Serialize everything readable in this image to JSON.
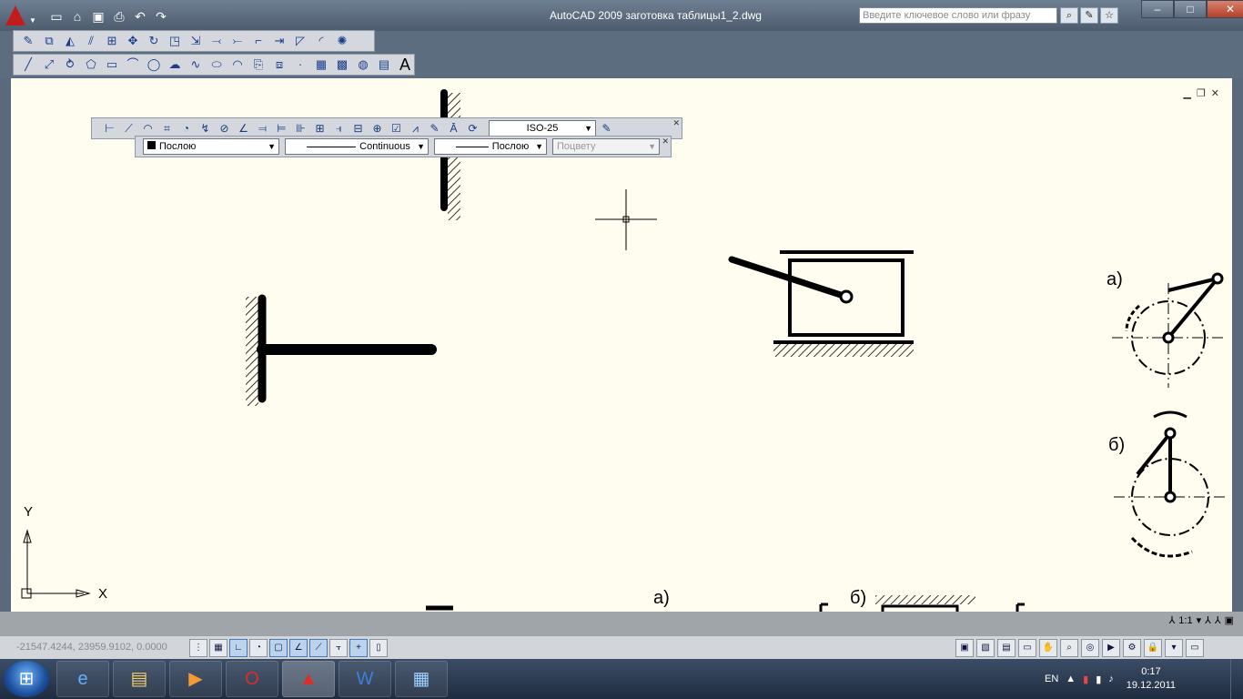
{
  "titlebar": {
    "title": "AutoCAD 2009 заготовка таблицы1_2.dwg",
    "search_placeholder": "Введите ключевое слово или фразу",
    "qat_icons": [
      "new-icon",
      "open-icon",
      "save-icon",
      "print-icon",
      "undo-icon",
      "redo-icon"
    ],
    "info_icons": [
      "search-icon",
      "communication-icon",
      "favorites-icon"
    ],
    "window_controls": {
      "minimize": "–",
      "maximize": "□",
      "close": "✕"
    }
  },
  "toolbars": {
    "modify_icons": [
      "erase-icon",
      "copy-icon",
      "mirror-icon",
      "offset-icon",
      "array-icon",
      "move-icon",
      "rotate-icon",
      "scale-icon",
      "stretch-icon",
      "trim-icon",
      "extend-icon",
      "break-icon",
      "join-icon",
      "chamfer-icon",
      "fillet-icon",
      "explode-icon"
    ],
    "draw_icons": [
      "line-icon",
      "construction-line-icon",
      "polyline-icon",
      "polygon-icon",
      "rectangle-icon",
      "arc-icon",
      "circle-icon",
      "revision-cloud-icon",
      "spline-icon",
      "ellipse-icon",
      "ellipse-arc-icon",
      "insert-block-icon",
      "make-block-icon",
      "point-icon",
      "hatch-icon",
      "gradient-icon",
      "region-icon",
      "table-icon",
      "multiline-text-icon"
    ],
    "multiline_text_label": "A"
  },
  "dimension_toolbar": {
    "dimstyle": "ISO-25"
  },
  "properties_toolbar": {
    "color": "Послою",
    "linetype": "Continuous",
    "lineweight": "Послою",
    "plotstyle": "Поцвету"
  },
  "drawing": {
    "labels": {
      "a_right": "а)",
      "b_right": "б)",
      "a_bottom": "а)",
      "b_bottom": "б)"
    },
    "ucs": {
      "x_label": "X",
      "y_label": "Y"
    }
  },
  "statusbar": {
    "coordinates": "-21547.4244, 23959.9102, 0.0000",
    "annotation_scale": "1:1"
  },
  "taskbar": {
    "language": "EN",
    "time": "0:17",
    "date": "19.12.2011"
  }
}
